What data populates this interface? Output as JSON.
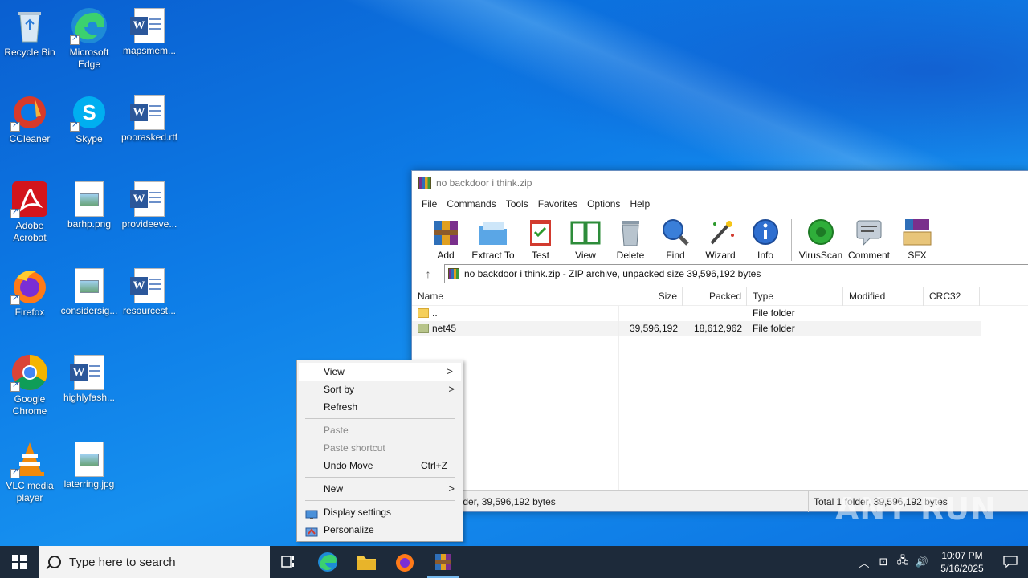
{
  "desktop_icons": [
    {
      "label": "Recycle Bin",
      "icon": "recycle-bin-icon"
    },
    {
      "label": "Microsoft Edge",
      "icon": "edge-icon"
    },
    {
      "label": "mapsmem...",
      "icon": "word-document-icon"
    },
    {
      "label": "CCleaner",
      "icon": "ccleaner-icon"
    },
    {
      "label": "Skype",
      "icon": "skype-icon"
    },
    {
      "label": "poorasked.rtf",
      "icon": "word-document-icon"
    },
    {
      "label": "Adobe Acrobat",
      "icon": "acrobat-icon"
    },
    {
      "label": "barhp.png",
      "icon": "image-file-icon"
    },
    {
      "label": "provideeve...",
      "icon": "word-document-icon"
    },
    {
      "label": "Firefox",
      "icon": "firefox-icon"
    },
    {
      "label": "considersig...",
      "icon": "image-file-icon"
    },
    {
      "label": "resourcest...",
      "icon": "word-document-icon"
    },
    {
      "label": "Google Chrome",
      "icon": "chrome-icon"
    },
    {
      "label": "highlyfash...",
      "icon": "word-document-icon"
    },
    {
      "label": "VLC media player",
      "icon": "vlc-icon"
    },
    {
      "label": "laterring.jpg",
      "icon": "image-file-icon"
    }
  ],
  "winrar": {
    "title": "no backdoor i think.zip",
    "menu": [
      "File",
      "Commands",
      "Tools",
      "Favorites",
      "Options",
      "Help"
    ],
    "toolbar": [
      "Add",
      "Extract To",
      "Test",
      "View",
      "Delete",
      "Find",
      "Wizard",
      "Info",
      "VirusScan",
      "Comment",
      "SFX"
    ],
    "address": "no backdoor i think.zip - ZIP archive, unpacked size 39,596,192 bytes",
    "columns": {
      "name": "Name",
      "size": "Size",
      "packed": "Packed",
      "type": "Type",
      "modified": "Modified",
      "crc": "CRC32"
    },
    "rows": [
      {
        "name": "..",
        "size": "",
        "packed": "",
        "type": "File folder"
      },
      {
        "name": "net45",
        "size": "39,596,192",
        "packed": "18,612,962",
        "type": "File folder"
      }
    ],
    "status_left": "ected 1 folder, 39,596,192 bytes",
    "status_right": "Total 1 folder, 39,596,192 bytes"
  },
  "context_menu": {
    "view": "View",
    "sort_by": "Sort by",
    "refresh": "Refresh",
    "paste": "Paste",
    "paste_shortcut": "Paste shortcut",
    "undo_move": "Undo Move",
    "undo_shortcut": "Ctrl+Z",
    "new": "New",
    "display_settings": "Display settings",
    "personalize": "Personalize"
  },
  "taskbar": {
    "search_placeholder": "Type here to search",
    "time": "10:07 PM",
    "date": "5/16/2025"
  },
  "watermark": "ANY RUN",
  "colors": {
    "taskbar": "#1d2a3a",
    "accent": "#0a78e6"
  }
}
